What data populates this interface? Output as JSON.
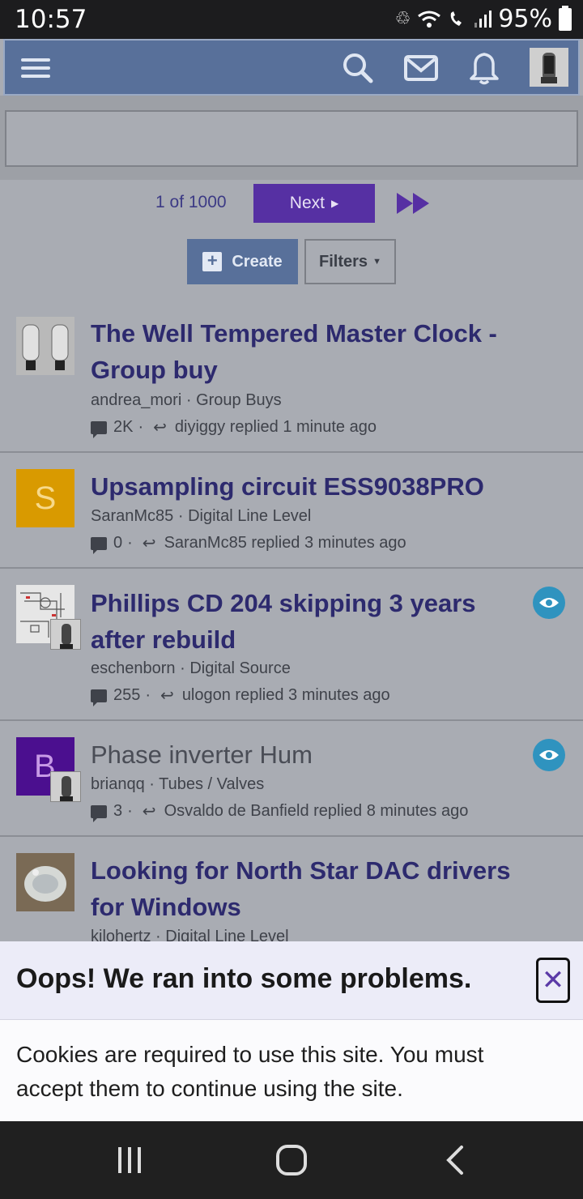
{
  "status_bar": {
    "time": "10:57",
    "battery": "95%"
  },
  "header": {
    "menu_icon": "hamburger-icon",
    "search_icon": "search-icon",
    "mail_icon": "mail-icon",
    "bell_icon": "bell-icon",
    "accent_color": "#58709a"
  },
  "pagination": {
    "pages": "1 of 1000",
    "next_label": "Next",
    "last_icon": "fast-forward-icon",
    "button_color": "#5630a3"
  },
  "actions": {
    "create_label": "Create",
    "filters_label": "Filters"
  },
  "threads": [
    {
      "title": "The Well Tempered Master Clock - Group buy",
      "author": "andrea_mori",
      "forum": "Group Buys",
      "replies": "2K",
      "last": "diyiggy replied 1 minute ago",
      "unread": true,
      "watched": false
    },
    {
      "title": "Upsampling circuit ESS9038PRO",
      "author": "SaranMc85",
      "forum": "Digital Line Level",
      "replies": "0",
      "last": "SaranMc85 replied 3 minutes ago",
      "avatar_letter": "S",
      "avatar_color": "#d99a00",
      "unread": true,
      "watched": false
    },
    {
      "title": "Phillips CD 204 skipping 3 years after rebuild",
      "author": "eschenborn",
      "forum": "Digital Source",
      "replies": "255",
      "last": "ulogon replied 3 minutes ago",
      "unread": true,
      "watched": true
    },
    {
      "title": "Phase inverter Hum",
      "author": "brianqq",
      "forum": "Tubes / Valves",
      "replies": "3",
      "last": "Osvaldo de Banfield replied 8 minutes ago",
      "avatar_letter": "B",
      "avatar_color": "#4b0f8f",
      "unread": false,
      "watched": true
    },
    {
      "title": "Looking for North Star DAC drivers for Windows",
      "author": "kilohertz",
      "forum": "Digital Line Level",
      "unread": true,
      "watched": false
    }
  ],
  "cookie_notice": {
    "title": "Oops! We ran into some problems.",
    "message": "Cookies are required to use this site. You must accept them to continue using the site.",
    "close_icon": "close-icon"
  },
  "sep": " · "
}
